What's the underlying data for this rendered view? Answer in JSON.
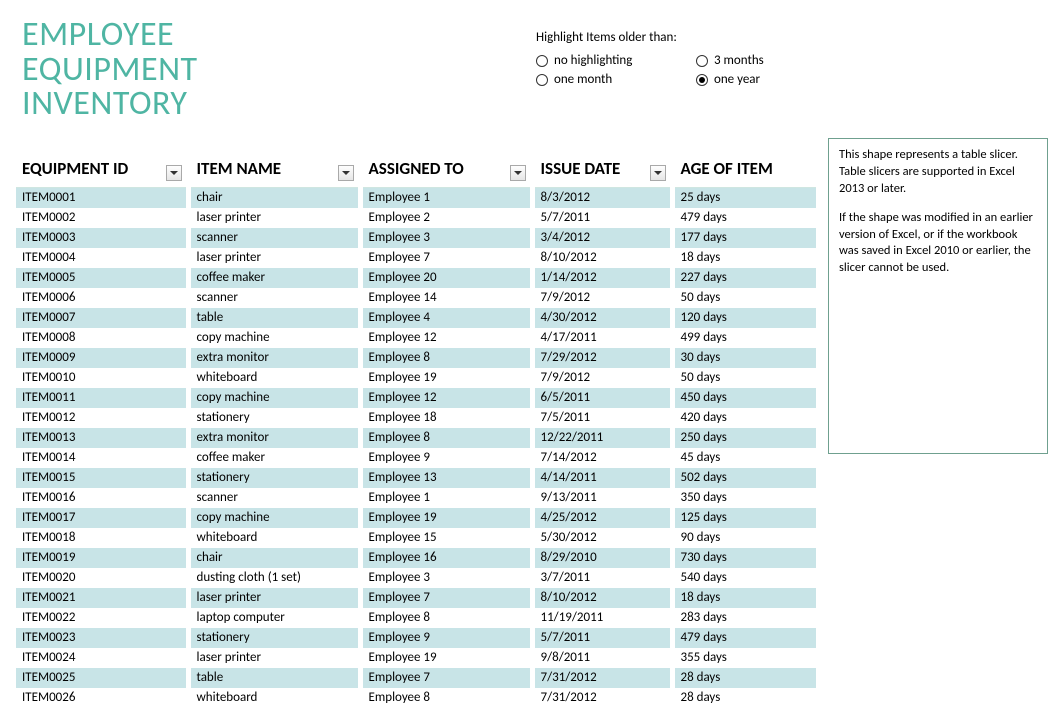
{
  "title_line1": "EMPLOYEE",
  "title_line2": "EQUIPMENT",
  "title_line3": "INVENTORY",
  "highlight": {
    "label": "Highlight Items older than:",
    "options": {
      "none": "no highlighting",
      "one_month": "one month",
      "three_months": "3 months",
      "one_year": "one year"
    },
    "selected": "one_year"
  },
  "slicer": {
    "p1": "This shape represents a table slicer. Table slicers are supported in Excel 2013 or later.",
    "p2": "If the shape was modified in an earlier version of Excel, or if the workbook was saved in Excel 2010 or earlier, the slicer cannot be used."
  },
  "headers": {
    "equipment_id": "EQUIPMENT ID",
    "item_name": "ITEM NAME",
    "assigned_to": "ASSIGNED TO",
    "issue_date": "ISSUE DATE",
    "age": "AGE OF ITEM"
  },
  "rows": [
    {
      "id": "ITEM0001",
      "name": "chair",
      "assigned": "Employee 1",
      "date": "8/3/2012",
      "age": "25 days"
    },
    {
      "id": "ITEM0002",
      "name": "laser printer",
      "assigned": "Employee 2",
      "date": "5/7/2011",
      "age": "479 days"
    },
    {
      "id": "ITEM0003",
      "name": "scanner",
      "assigned": "Employee 3",
      "date": "3/4/2012",
      "age": "177 days"
    },
    {
      "id": "ITEM0004",
      "name": "laser printer",
      "assigned": "Employee 7",
      "date": "8/10/2012",
      "age": "18 days"
    },
    {
      "id": "ITEM0005",
      "name": "coffee maker",
      "assigned": "Employee 20",
      "date": "1/14/2012",
      "age": "227 days"
    },
    {
      "id": "ITEM0006",
      "name": "scanner",
      "assigned": "Employee 14",
      "date": "7/9/2012",
      "age": "50 days"
    },
    {
      "id": "ITEM0007",
      "name": "table",
      "assigned": "Employee 4",
      "date": "4/30/2012",
      "age": "120 days"
    },
    {
      "id": "ITEM0008",
      "name": "copy machine",
      "assigned": "Employee 12",
      "date": "4/17/2011",
      "age": "499 days"
    },
    {
      "id": "ITEM0009",
      "name": "extra monitor",
      "assigned": "Employee 8",
      "date": "7/29/2012",
      "age": "30 days"
    },
    {
      "id": "ITEM0010",
      "name": "whiteboard",
      "assigned": "Employee 19",
      "date": "7/9/2012",
      "age": "50 days"
    },
    {
      "id": "ITEM0011",
      "name": "copy machine",
      "assigned": "Employee 12",
      "date": "6/5/2011",
      "age": "450 days"
    },
    {
      "id": "ITEM0012",
      "name": "stationery",
      "assigned": "Employee 18",
      "date": "7/5/2011",
      "age": "420 days"
    },
    {
      "id": "ITEM0013",
      "name": "extra monitor",
      "assigned": "Employee 8",
      "date": "12/22/2011",
      "age": "250 days"
    },
    {
      "id": "ITEM0014",
      "name": "coffee maker",
      "assigned": "Employee 9",
      "date": "7/14/2012",
      "age": "45 days"
    },
    {
      "id": "ITEM0015",
      "name": "stationery",
      "assigned": "Employee 13",
      "date": "4/14/2011",
      "age": "502 days"
    },
    {
      "id": "ITEM0016",
      "name": "scanner",
      "assigned": "Employee 1",
      "date": "9/13/2011",
      "age": "350 days"
    },
    {
      "id": "ITEM0017",
      "name": "copy machine",
      "assigned": "Employee 19",
      "date": "4/25/2012",
      "age": "125 days"
    },
    {
      "id": "ITEM0018",
      "name": "whiteboard",
      "assigned": "Employee 15",
      "date": "5/30/2012",
      "age": "90 days"
    },
    {
      "id": "ITEM0019",
      "name": "chair",
      "assigned": "Employee 16",
      "date": "8/29/2010",
      "age": "730 days"
    },
    {
      "id": "ITEM0020",
      "name": "dusting cloth (1 set)",
      "assigned": "Employee 3",
      "date": "3/7/2011",
      "age": "540 days"
    },
    {
      "id": "ITEM0021",
      "name": "laser printer",
      "assigned": "Employee 7",
      "date": "8/10/2012",
      "age": "18 days"
    },
    {
      "id": "ITEM0022",
      "name": "laptop computer",
      "assigned": "Employee 8",
      "date": "11/19/2011",
      "age": "283 days"
    },
    {
      "id": "ITEM0023",
      "name": "stationery",
      "assigned": "Employee 9",
      "date": "5/7/2011",
      "age": "479 days"
    },
    {
      "id": "ITEM0024",
      "name": "laser printer",
      "assigned": "Employee 19",
      "date": "9/8/2011",
      "age": "355 days"
    },
    {
      "id": "ITEM0025",
      "name": "table",
      "assigned": "Employee 7",
      "date": "7/31/2012",
      "age": "28 days"
    },
    {
      "id": "ITEM0026",
      "name": "whiteboard",
      "assigned": "Employee 8",
      "date": "7/31/2012",
      "age": "28 days"
    }
  ]
}
